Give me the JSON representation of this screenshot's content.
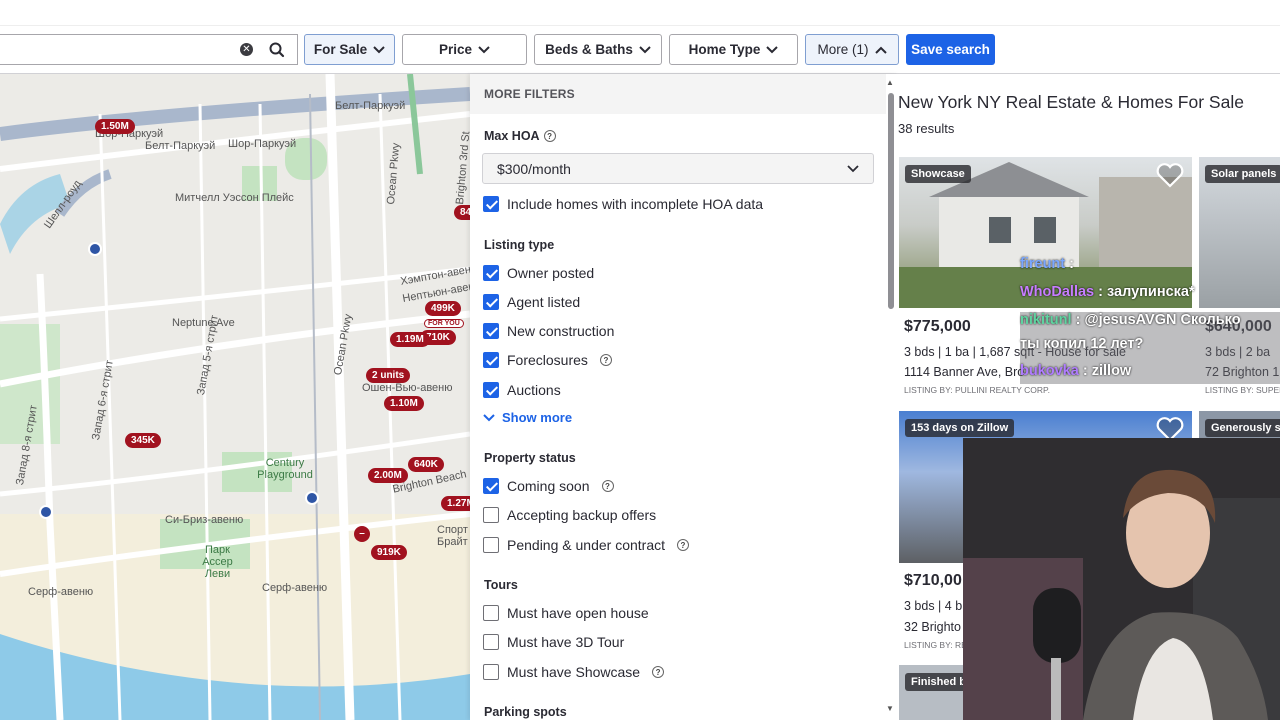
{
  "toolbar": {
    "filters": [
      {
        "label": "For Sale",
        "active": true
      },
      {
        "label": "Price",
        "active": false
      },
      {
        "label": "Beds & Baths",
        "active": false
      },
      {
        "label": "Home Type",
        "active": false
      },
      {
        "label": "More (1)",
        "active": true
      }
    ],
    "save_label": "Save search",
    "accent": "#1d63e6"
  },
  "map": {
    "labels": [
      "Шор-Паркуэй",
      "Белт-Паркуэй",
      "Шор-Паркуэй",
      "Белт-Паркуэй",
      "Митчелл Уэссон Плейс",
      "Шелл-роуд",
      "Ocean Pkwy",
      "Brighton 3rd St",
      "Хэмптон-авеню",
      "Нептьюн-авеню",
      "Neptune Ave",
      "Запад 5-я стрит",
      "Запад 6-я стрит",
      "Запад 8-я стрит",
      "Ocean Pkwy",
      "Century Playground",
      "Ошен-Вью-авеню",
      "Brighton Beach",
      "Си-Бриз-авеню",
      "Парк Ассер Леви",
      "Серф-авеню",
      "Серф-авеню",
      "Спорт Брайт"
    ],
    "pins": [
      "1.50M",
      "84",
      "499K",
      "710K",
      "1.19M",
      "2 units",
      "1.10M",
      "345K",
      "640K",
      "2.00M",
      "1.27M",
      "919K"
    ],
    "for_you": "FOR YOU"
  },
  "panel": {
    "title": "MORE FILTERS",
    "max_hoa_label": "Max HOA",
    "hoa_value": "$300/month",
    "include_incomplete": "Include homes with incomplete HOA data",
    "listing_type_label": "Listing type",
    "listing_types": [
      "Owner posted",
      "Agent listed",
      "New construction",
      "Foreclosures",
      "Auctions"
    ],
    "show_more": "Show more",
    "property_status_label": "Property status",
    "statuses": [
      "Coming soon",
      "Accepting backup offers",
      "Pending & under contract"
    ],
    "tours_label": "Tours",
    "tours": [
      "Must have open house",
      "Must have 3D Tour",
      "Must have Showcase"
    ],
    "parking_label": "Parking spots"
  },
  "results": {
    "title": "New York NY Real Estate & Homes For Sale",
    "count": "38 results",
    "card1": {
      "badge": "Showcase",
      "price": "$775,000",
      "facts": "3 bds | 1 ba | 1,687 sqft - House for sale",
      "address": "1114 Banner Ave, Bro",
      "broker": "LISTING BY: PULLINI REALTY CORP."
    },
    "card2": {
      "badge": "Solar panels",
      "price": "$640,000",
      "facts": "3 bds | 2 ba",
      "address": "72 Brighton 1",
      "broker": "LISTING BY: SUPER"
    },
    "card3": {
      "badge": "153 days on Zillow",
      "price": "$710,00",
      "facts": "3 bds | 4 b",
      "address": "32 Brighto",
      "broker": "LISTING BY: RE"
    },
    "card4": {
      "badge": "Generously si"
    },
    "card5": {
      "badge": "Finished b"
    }
  },
  "chat": [
    {
      "user": "fireunt",
      "text": " :",
      "color": "#7aa7ff"
    },
    {
      "user": "WhoDallas",
      "text": " : залупинска*",
      "color": "#c77dff"
    },
    {
      "user": "nikitunl",
      "text": " : @jesusAVGN Сколько",
      "color": "#5fd3a0"
    },
    {
      "user": "",
      "text": "ты копил 12 лет?",
      "color": "#ffffff"
    },
    {
      "user": "bukovka",
      "text": " : zillow",
      "color": "#b07cff"
    }
  ]
}
